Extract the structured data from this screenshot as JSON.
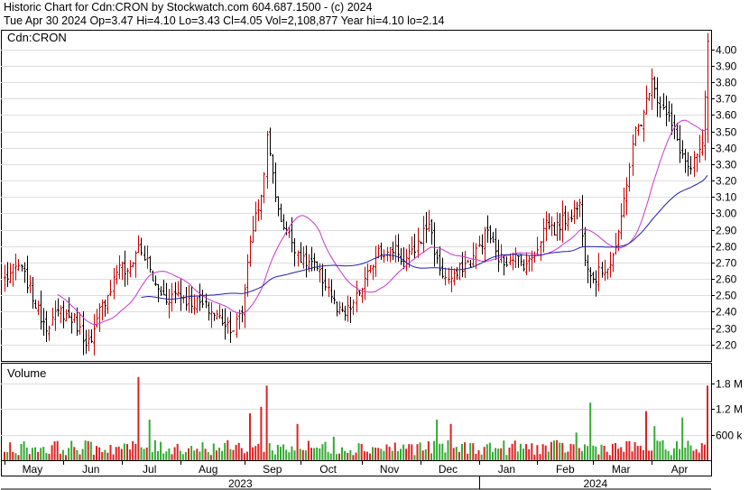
{
  "header": {
    "line1": "Historic Chart for Cdn:CRON by Stockwatch.com 604.687.1500 - (c) 2024",
    "line2": "Tue Apr 30 2024   Op=3.47  Hi=4.10  Lo=3.43  Cl=4.05  Vol=2,108,877  Year hi=4.10  lo=2.14"
  },
  "colors": {
    "up": "#cc0000",
    "down": "#000000",
    "ma_short": "#cc33cc",
    "ma_long": "#1f1fb0",
    "vol_up": "#dd2222",
    "vol_down": "#33aa33",
    "grid": "#dddddd"
  },
  "chart_data": [
    {
      "type": "ohlc",
      "legend": "Cdn:CRON",
      "ylim": [
        2.1,
        4.12
      ],
      "y_ticks": [
        "2.20",
        "2.30",
        "2.40",
        "2.50",
        "2.60",
        "2.70",
        "2.80",
        "2.90",
        "3.00",
        "3.10",
        "3.20",
        "3.30",
        "3.40",
        "3.50",
        "3.60",
        "3.70",
        "3.80",
        "3.90",
        "4.00"
      ],
      "grid": true,
      "close_anchors": [
        [
          0,
          2.6
        ],
        [
          5,
          2.68
        ],
        [
          8,
          2.58
        ],
        [
          12,
          2.4
        ],
        [
          15,
          2.32
        ],
        [
          20,
          2.4
        ],
        [
          25,
          2.35
        ],
        [
          28,
          2.25
        ],
        [
          31,
          2.2
        ],
        [
          34,
          2.4
        ],
        [
          38,
          2.55
        ],
        [
          41,
          2.7
        ],
        [
          44,
          2.62
        ],
        [
          46,
          2.72
        ],
        [
          48,
          2.8
        ],
        [
          51,
          2.7
        ],
        [
          54,
          2.55
        ],
        [
          58,
          2.48
        ],
        [
          62,
          2.52
        ],
        [
          66,
          2.46
        ],
        [
          70,
          2.45
        ],
        [
          74,
          2.4
        ],
        [
          78,
          2.35
        ],
        [
          82,
          2.3
        ],
        [
          85,
          2.4
        ],
        [
          88,
          2.85
        ],
        [
          92,
          3.1
        ],
        [
          94,
          3.45
        ],
        [
          96,
          3.25
        ],
        [
          98,
          3.0
        ],
        [
          101,
          2.9
        ],
        [
          104,
          2.8
        ],
        [
          107,
          2.7
        ],
        [
          110,
          2.7
        ],
        [
          113,
          2.62
        ],
        [
          116,
          2.55
        ],
        [
          119,
          2.4
        ],
        [
          122,
          2.38
        ],
        [
          125,
          2.45
        ],
        [
          128,
          2.55
        ],
        [
          131,
          2.65
        ],
        [
          134,
          2.8
        ],
        [
          137,
          2.75
        ],
        [
          140,
          2.8
        ],
        [
          143,
          2.7
        ],
        [
          146,
          2.75
        ],
        [
          149,
          2.85
        ],
        [
          152,
          2.95
        ],
        [
          155,
          2.7
        ],
        [
          158,
          2.6
        ],
        [
          161,
          2.6
        ],
        [
          164,
          2.68
        ],
        [
          167,
          2.7
        ],
        [
          170,
          2.8
        ],
        [
          173,
          2.9
        ],
        [
          176,
          2.75
        ],
        [
          179,
          2.7
        ],
        [
          182,
          2.75
        ],
        [
          185,
          2.7
        ],
        [
          188,
          2.7
        ],
        [
          191,
          2.8
        ],
        [
          194,
          2.95
        ],
        [
          197,
          2.9
        ],
        [
          200,
          2.95
        ],
        [
          203,
          3.0
        ],
        [
          206,
          3.05
        ],
        [
          208,
          2.75
        ],
        [
          211,
          2.6
        ],
        [
          214,
          2.65
        ],
        [
          217,
          2.7
        ],
        [
          220,
          2.85
        ],
        [
          223,
          3.2
        ],
        [
          226,
          3.5
        ],
        [
          229,
          3.6
        ],
        [
          232,
          3.85
        ],
        [
          234,
          3.7
        ],
        [
          237,
          3.6
        ],
        [
          240,
          3.5
        ],
        [
          243,
          3.35
        ],
        [
          246,
          3.25
        ],
        [
          248,
          3.35
        ],
        [
          250,
          3.4
        ],
        [
          252,
          4.05
        ]
      ],
      "ma_short": {
        "period": 20
      },
      "ma_long": {
        "period": 50
      }
    },
    {
      "type": "bar",
      "title": "Volume",
      "y_ticks": [
        "600 k",
        "1.2 M",
        "1.8 M"
      ],
      "x_month_labels": [
        "May",
        "Jun",
        "Jul",
        "Aug",
        "Sep",
        "Oct",
        "Nov",
        "Dec",
        "Jan",
        "Feb",
        "Mar",
        "Apr"
      ],
      "x_year_labels": [
        "2023",
        "2024"
      ],
      "spikes": [
        [
          48,
          1.95
        ],
        [
          52,
          0.95
        ],
        [
          88,
          1.1
        ],
        [
          92,
          1.25
        ],
        [
          94,
          1.75
        ],
        [
          105,
          0.85
        ],
        [
          118,
          0.55
        ],
        [
          155,
          0.95
        ],
        [
          160,
          0.85
        ],
        [
          205,
          0.65
        ],
        [
          210,
          1.35
        ],
        [
          230,
          1.15
        ],
        [
          233,
          0.8
        ],
        [
          243,
          1.0
        ],
        [
          250,
          0.4
        ],
        [
          252,
          1.75
        ]
      ]
    }
  ]
}
